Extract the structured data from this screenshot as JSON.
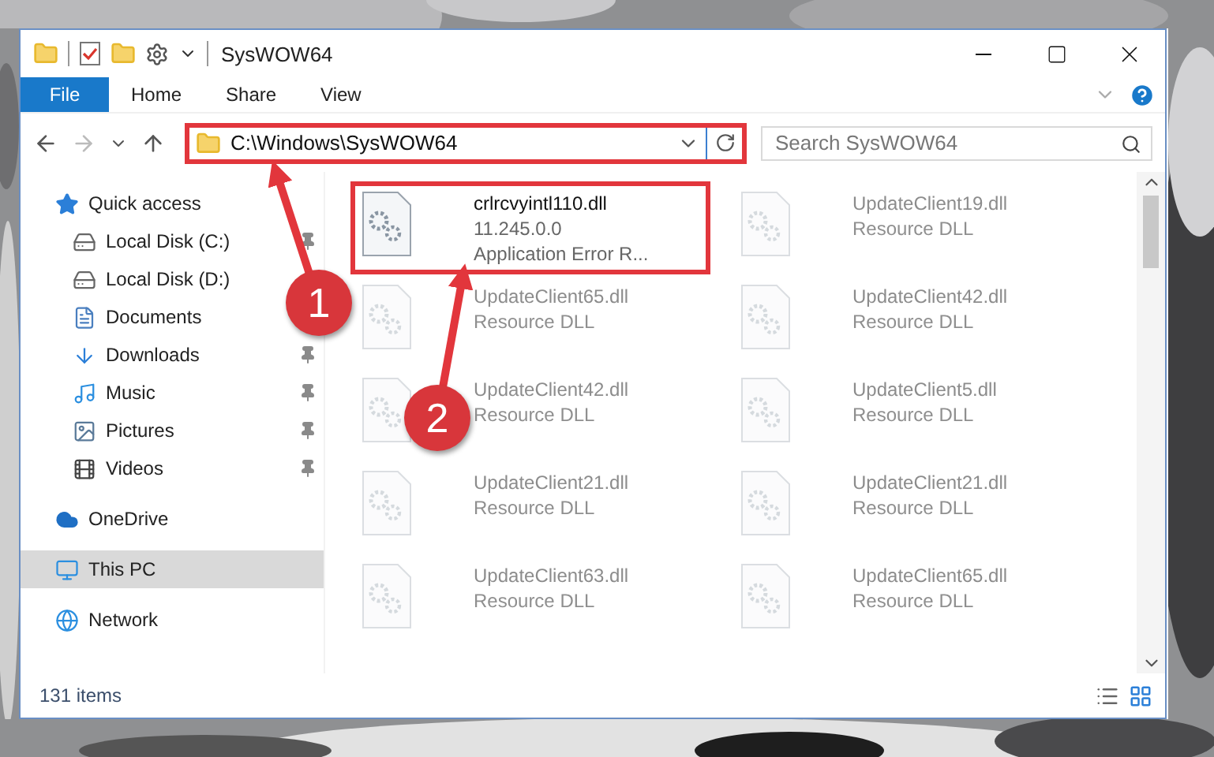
{
  "window": {
    "title": "SysWOW64"
  },
  "ribbon_tabs": [
    {
      "label": "File",
      "selected": true
    },
    {
      "label": "Home",
      "selected": false
    },
    {
      "label": "Share",
      "selected": false
    },
    {
      "label": "View",
      "selected": false
    }
  ],
  "address": {
    "path": "C:\\Windows\\SysWOW64",
    "highlighted": true
  },
  "search": {
    "placeholder": "Search SysWOW64"
  },
  "sidebar": {
    "items": [
      {
        "label": "Quick access",
        "kind": "star",
        "selected": false,
        "children": [
          {
            "label": "Local Disk (C:)",
            "kind": "drive",
            "pinned": true,
            "selected": false
          },
          {
            "label": "Local Disk (D:)",
            "kind": "drive",
            "pinned": false,
            "selected": false
          },
          {
            "label": "Documents",
            "kind": "document",
            "pinned": false,
            "selected": false
          },
          {
            "label": "Downloads",
            "kind": "download",
            "pinned": true,
            "selected": false
          },
          {
            "label": "Music",
            "kind": "music",
            "pinned": true,
            "selected": false
          },
          {
            "label": "Pictures",
            "kind": "pictures",
            "pinned": true,
            "selected": false
          },
          {
            "label": "Videos",
            "kind": "videos",
            "pinned": true,
            "selected": false
          }
        ]
      },
      {
        "label": "OneDrive",
        "kind": "cloud",
        "selected": false
      },
      {
        "label": "This PC",
        "kind": "pc",
        "selected": true
      },
      {
        "label": "Network",
        "kind": "network",
        "selected": false
      }
    ]
  },
  "files": [
    {
      "name": "crlrcvyintl110.dll",
      "lines": [
        "11.245.0.0",
        "Application Error R..."
      ],
      "highlighted": true,
      "faded": false
    },
    {
      "name": "UpdateClient19.dll",
      "lines": [
        "Resource DLL"
      ],
      "highlighted": false,
      "faded": true
    },
    {
      "name": "UpdateClient65.dll",
      "lines": [
        "Resource DLL"
      ],
      "highlighted": false,
      "faded": true
    },
    {
      "name": "UpdateClient42.dll",
      "lines": [
        "Resource DLL"
      ],
      "highlighted": false,
      "faded": true
    },
    {
      "name": "UpdateClient42.dll",
      "lines": [
        "Resource DLL"
      ],
      "highlighted": false,
      "faded": true
    },
    {
      "name": "UpdateClient5.dll",
      "lines": [
        "Resource DLL"
      ],
      "highlighted": false,
      "faded": true
    },
    {
      "name": "UpdateClient21.dll",
      "lines": [
        "Resource DLL"
      ],
      "highlighted": false,
      "faded": true
    },
    {
      "name": "UpdateClient21.dll",
      "lines": [
        "Resource DLL"
      ],
      "highlighted": false,
      "faded": true
    },
    {
      "name": "UpdateClient63.dll",
      "lines": [
        "Resource DLL"
      ],
      "highlighted": false,
      "faded": true
    },
    {
      "name": "UpdateClient65.dll",
      "lines": [
        "Resource DLL"
      ],
      "highlighted": false,
      "faded": true
    }
  ],
  "status_bar": {
    "count": "131 items"
  },
  "callouts": [
    {
      "label": "1"
    },
    {
      "label": "2"
    }
  ]
}
